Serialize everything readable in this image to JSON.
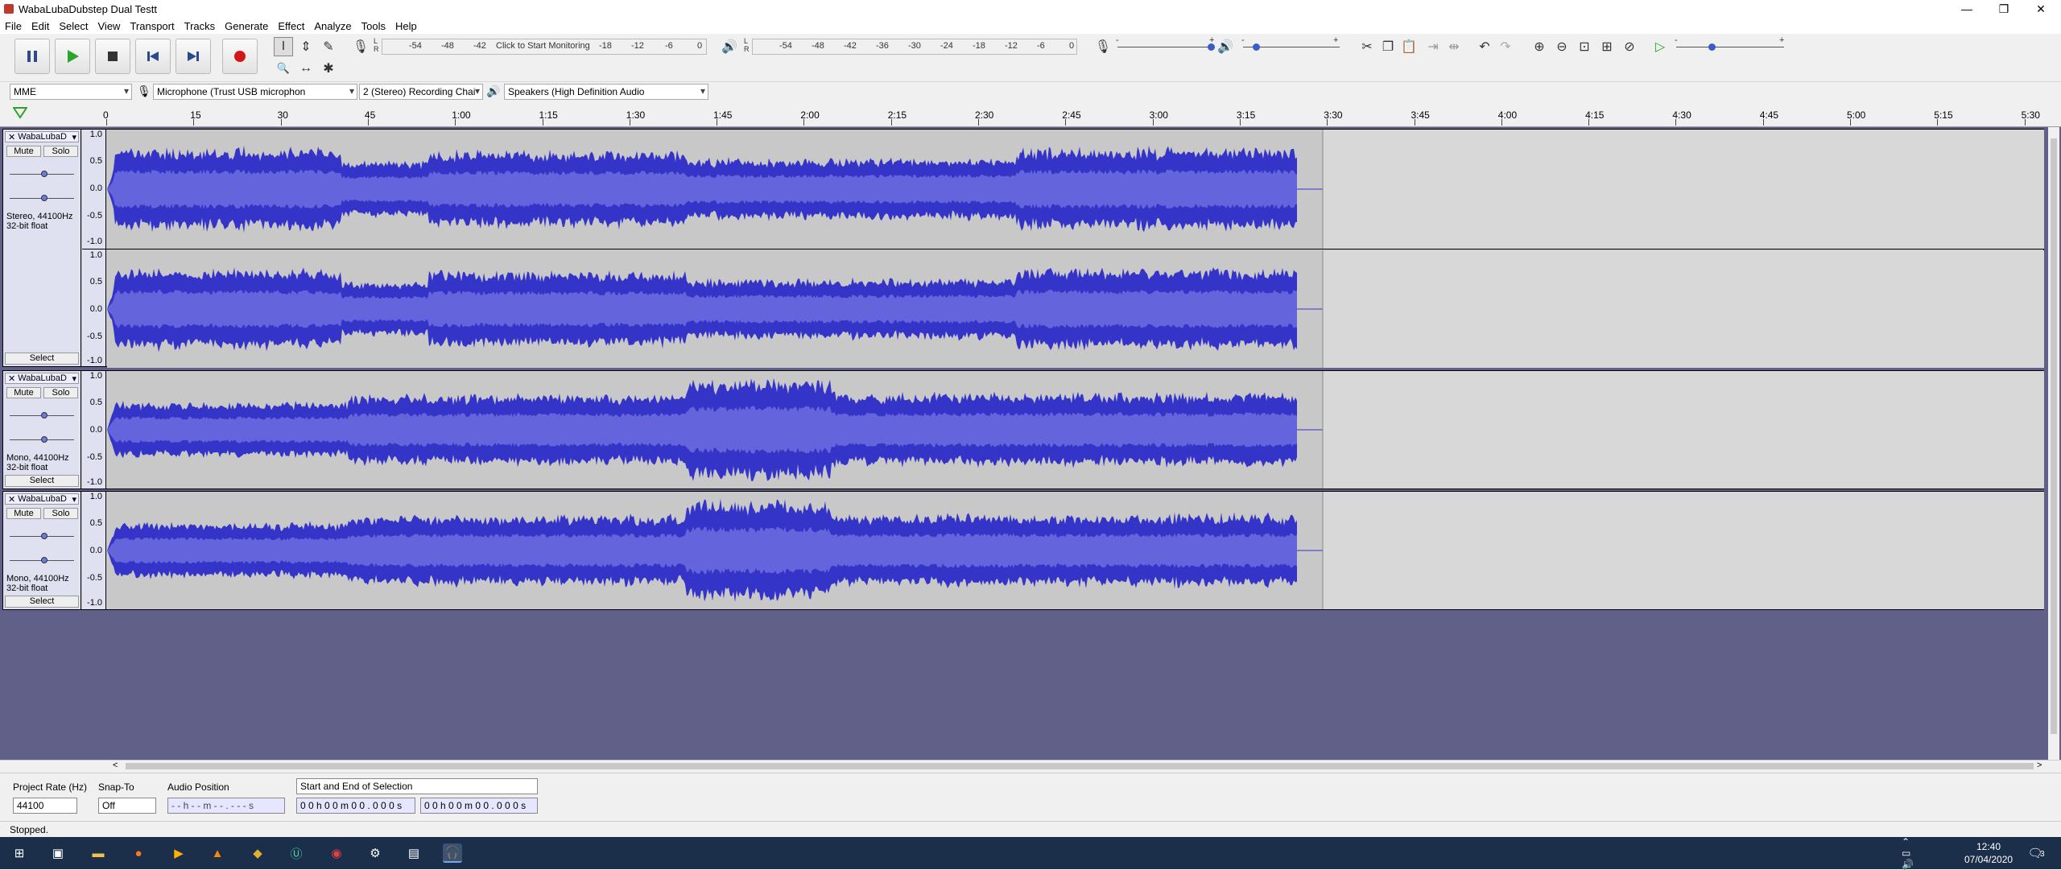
{
  "window": {
    "title": "WabaLubaDubstep Dual Testt",
    "minimize": "—",
    "restore": "❐",
    "close": "✕"
  },
  "menu": [
    "File",
    "Edit",
    "Select",
    "View",
    "Transport",
    "Tracks",
    "Generate",
    "Effect",
    "Analyze",
    "Tools",
    "Help"
  ],
  "transport_icons": [
    "pause-icon",
    "play-icon",
    "stop-icon",
    "skip-start-icon",
    "skip-end-icon",
    "record-icon"
  ],
  "tools": {
    "selection": "I",
    "envelope": "⇕",
    "draw": "✎",
    "zoom": "🔍",
    "timeshift": "↔",
    "multi": "✱"
  },
  "record_meter": {
    "click_text": "Click to Start Monitoring",
    "ticks_left": [
      "-54",
      "-48",
      "-42"
    ],
    "ticks_right": [
      "-18",
      "-12",
      "-6",
      "0"
    ],
    "lr": "L\nR"
  },
  "play_meter": {
    "ticks": [
      "-54",
      "-48",
      "-42",
      "-36",
      "-30",
      "-24",
      "-18",
      "-12",
      "-6",
      "0"
    ]
  },
  "mixer": {
    "rec_minus": "-",
    "rec_plus": "+",
    "play_minus": "-",
    "play_plus": "+"
  },
  "devices": {
    "host": "MME",
    "mic": "Microphone (Trust USB microphon",
    "channels": "2 (Stereo) Recording Chai",
    "speakers": "Speakers (High Definition Audio"
  },
  "ruler_ticks": [
    "0",
    "15",
    "30",
    "45",
    "1:00",
    "1:15",
    "1:30",
    "1:45",
    "2:00",
    "2:15",
    "2:30",
    "2:45",
    "3:00",
    "3:15",
    "3:30",
    "3:45",
    "4:00",
    "4:15",
    "4:30",
    "4:45",
    "5:00",
    "5:15",
    "5:30"
  ],
  "tracks": [
    {
      "name": "WabaLubaD",
      "mute": "Mute",
      "solo": "Solo",
      "info1": "Stereo, 44100Hz",
      "info2": "32-bit float",
      "select": "Select",
      "scale": [
        "1.0",
        "0.5",
        "0.0",
        "-0.5",
        "-1.0"
      ]
    },
    {
      "name": "WabaLubaD",
      "mute": "Mute",
      "solo": "Solo",
      "info1": "Mono, 44100Hz",
      "info2": "32-bit float",
      "select": "Select",
      "scale": [
        "1.0",
        "0.5",
        "0.0",
        "-0.5",
        "-1.0"
      ]
    },
    {
      "name": "WabaLubaD",
      "mute": "Mute",
      "solo": "Solo",
      "info1": "Mono, 44100Hz",
      "info2": "32-bit float",
      "select": "Select",
      "scale": [
        "1.0",
        "0.5",
        "0.0",
        "-0.5",
        "-1.0"
      ]
    }
  ],
  "second_channel_scale": [
    "1.0",
    "0.5",
    "0.0",
    "-0.5",
    "-1.0"
  ],
  "selection": {
    "project_rate_label": "Project Rate (Hz)",
    "project_rate": "44100",
    "snap_label": "Snap-To",
    "snap": "Off",
    "audio_pos_label": "Audio Position",
    "audio_pos": "- - h - - m - - . - - - s",
    "range_label": "Start and End of Selection",
    "start": "0 0 h 0 0 m 0 0 . 0 0 0 s",
    "end": "0 0 h 0 0 m 0 0 . 0 0 0 s"
  },
  "status": "Stopped.",
  "taskbar": {
    "time": "12:40",
    "date": "07/04/2020",
    "notif": "3"
  },
  "colors": {
    "wave": "#3434c8",
    "wave_rms": "#6464dc",
    "track_bg": "#c8c8c8",
    "empty_bg": "#606088"
  }
}
